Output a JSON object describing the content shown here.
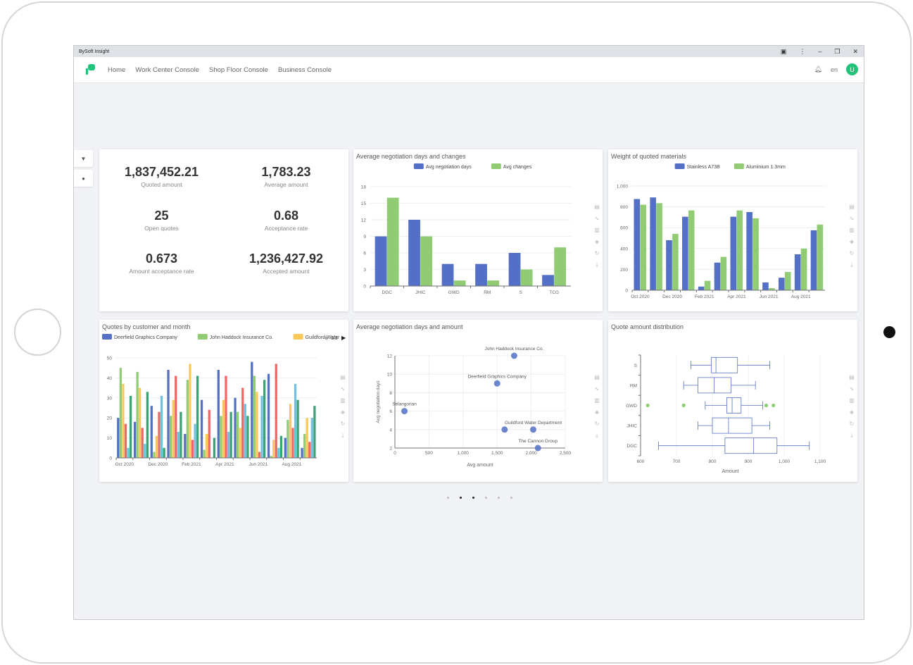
{
  "app": {
    "title": "BySoft Insight",
    "nav": [
      "Home",
      "Work Center Console",
      "Shop Floor Console",
      "Business Console"
    ],
    "lang": "en",
    "avatar": "U",
    "icons": [
      "translate-icon",
      "more-icon",
      "minimize-icon",
      "restore-icon",
      "close-icon",
      "bell-icon"
    ]
  },
  "sidebar": {
    "tools": [
      "filter-icon",
      "settings-icon"
    ]
  },
  "kpis": [
    {
      "value": "1,837,452.21",
      "label": "Quoted amount"
    },
    {
      "value": "1,783.23",
      "label": "Average amount"
    },
    {
      "value": "25",
      "label": "Open quotes"
    },
    {
      "value": "0.68",
      "label": "Acceptance rate"
    },
    {
      "value": "0.673",
      "label": "Amount acceptance rate"
    },
    {
      "value": "1,236,427.92",
      "label": "Accepted amount"
    }
  ],
  "colors": {
    "blue": "#5470c6",
    "green": "#91cc75",
    "yellow": "#fac858",
    "red": "#ee6666",
    "lightblue": "#73c0de",
    "darkgreen": "#3ba272",
    "brand": "#1fc47a"
  },
  "pagination": {
    "pages": 6,
    "current": 3
  },
  "chart_data": [
    {
      "type": "bar",
      "title": "Average negotiation days and changes",
      "categories": [
        "DGC",
        "JHIC",
        "GWD",
        "RM",
        "S",
        "TCG"
      ],
      "ylim": [
        0,
        18
      ],
      "yticks": [
        0,
        3,
        6,
        9,
        12,
        15,
        18
      ],
      "legend": "top",
      "grid": true,
      "series": [
        {
          "name": "Avg negotiation days",
          "color": "#5470c6",
          "values": [
            9,
            12,
            4,
            4,
            6,
            2
          ]
        },
        {
          "name": "Avg changes",
          "color": "#91cc75",
          "values": [
            16,
            9,
            1,
            1,
            3,
            7
          ]
        }
      ]
    },
    {
      "type": "bar",
      "title": "Weight of quoted materials",
      "categories": [
        "Oct 2020",
        "Nov 2020",
        "Dec 2020",
        "Jan 2021",
        "Feb 2021",
        "Mar 2021",
        "Apr 2021",
        "May 2021",
        "Jun 2021",
        "Jul 2021",
        "Aug 2021",
        "Sep 2021"
      ],
      "xtick_labels": [
        "Oct 2020",
        "",
        "Dec 2020",
        "",
        "Feb 2021",
        "",
        "Apr 2021",
        "",
        "Jun 2021",
        "",
        "Aug 2021",
        ""
      ],
      "ylim": [
        0,
        1000
      ],
      "yticks": [
        "0",
        "200",
        "400",
        "600",
        "800",
        "1,000"
      ],
      "legend": "top",
      "grid": true,
      "series": [
        {
          "name": "Stainless A73B",
          "color": "#5470c6",
          "values": [
            875,
            890,
            480,
            705,
            35,
            265,
            705,
            750,
            75,
            120,
            345,
            575
          ]
        },
        {
          "name": "Aluminium 1.3mm",
          "color": "#91cc75",
          "values": [
            820,
            835,
            540,
            765,
            90,
            320,
            765,
            690,
            20,
            175,
            400,
            630
          ]
        }
      ]
    },
    {
      "type": "bar",
      "title": "Quotes by customer and month",
      "categories": [
        "Oct 2020",
        "Nov 2020",
        "Dec 2020",
        "Jan 2021",
        "Feb 2021",
        "Mar 2021",
        "Apr 2021",
        "May 2021",
        "Jun 2021",
        "Jul 2021",
        "Aug 2021",
        "Sep 2021"
      ],
      "xtick_labels": [
        "Oct 2020",
        "",
        "Dec 2020",
        "",
        "Feb 2021",
        "",
        "Apr 2021",
        "",
        "Jun 2021",
        "",
        "Aug 2021",
        ""
      ],
      "ylim": [
        0,
        50
      ],
      "yticks": [
        "0",
        "10",
        "20",
        "30",
        "40",
        "50"
      ],
      "legend": "top",
      "legend_page": "1/3",
      "grid": true,
      "series": [
        {
          "name": "Deerfield Graphics Company",
          "color": "#5470c6",
          "values": [
            20,
            18,
            26,
            44,
            12,
            29,
            44,
            30,
            48,
            42,
            10,
            5
          ]
        },
        {
          "name": "John Haddock Insurance Co.",
          "color": "#91cc75",
          "values": [
            45,
            43,
            3,
            21,
            39,
            4,
            21,
            23,
            41,
            1,
            19,
            12
          ]
        },
        {
          "name": "Guildford Water",
          "color": "#fac858",
          "values": [
            37,
            35,
            11,
            29,
            47,
            12,
            29,
            15,
            33,
            9,
            27,
            20
          ]
        },
        {
          "color": "#ee6666",
          "values": [
            17,
            15,
            23,
            41,
            9,
            24,
            41,
            35,
            3,
            47,
            15,
            8
          ]
        },
        {
          "color": "#73c0de",
          "values": [
            5,
            7,
            31,
            13,
            17,
            0,
            13,
            27,
            31,
            5,
            37,
            20
          ]
        },
        {
          "color": "#3ba272",
          "values": [
            31,
            33,
            5,
            23,
            41,
            10,
            23,
            21,
            39,
            11,
            29,
            26
          ]
        }
      ]
    },
    {
      "type": "scatter",
      "title": "Average negotiation days and amount",
      "xlabel": "Avg amount",
      "ylabel": "Avg negotiation days",
      "xlim": [
        0,
        2500
      ],
      "ylim": [
        2,
        12
      ],
      "xticks": [
        "0",
        "500",
        "1,000",
        "1,500",
        "2,000",
        "2,500"
      ],
      "yticks": [
        "2",
        "4",
        "6",
        "8",
        "10",
        "12"
      ],
      "grid": true,
      "color": "#5470c6",
      "points": [
        {
          "x": 140,
          "y": 6,
          "label": "Selangorian"
        },
        {
          "x": 1500,
          "y": 9,
          "label": "Deerfield Graphics Company"
        },
        {
          "x": 1750,
          "y": 12,
          "label": "John Haddock Insurance Co."
        },
        {
          "x": 1610,
          "y": 4,
          "label": ""
        },
        {
          "x": 2030,
          "y": 4,
          "label": "Guildford Water Department"
        },
        {
          "x": 2100,
          "y": 2,
          "label": "The Cannon Group"
        }
      ]
    },
    {
      "type": "boxplot",
      "title": "Quote amount distribution",
      "xlabel": "Amount",
      "xlim": [
        600,
        1100
      ],
      "xticks": [
        "600",
        "700",
        "800",
        "900",
        "1,000",
        "1,100"
      ],
      "grid": true,
      "categories": [
        "S",
        "RM",
        "GWD",
        "JHIC",
        "DGC"
      ],
      "boxes": [
        [
          740,
          797,
          810,
          870,
          960
        ],
        [
          720,
          760,
          805,
          852,
          920
        ],
        [
          780,
          840,
          855,
          880,
          940
        ],
        [
          760,
          800,
          845,
          910,
          960
        ],
        [
          650,
          835,
          915,
          980,
          1070
        ]
      ],
      "outliers": [
        {
          "category": "GWD",
          "values": [
            620,
            720,
            950,
            970
          ]
        }
      ],
      "box_color": "#5470c6",
      "outlier_color": "#91cc75"
    }
  ],
  "toolbox": [
    "data-view-icon",
    "line-chart-icon",
    "bar-chart-icon",
    "stack-icon",
    "restore-icon",
    "download-icon"
  ]
}
